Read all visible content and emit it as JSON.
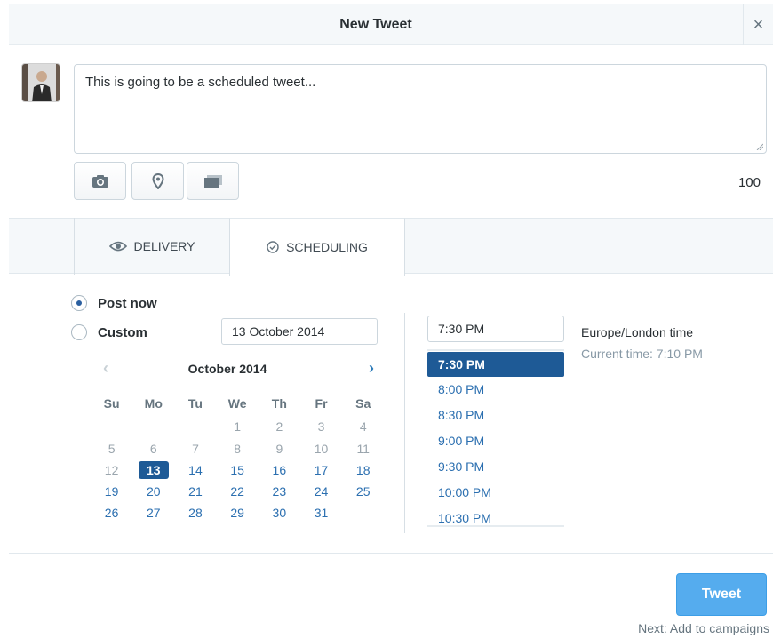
{
  "header": {
    "title": "New Tweet",
    "close_symbol": "×"
  },
  "composer": {
    "text": "This is going to be a scheduled tweet...",
    "char_count": "100",
    "media_buttons": [
      "camera-icon",
      "location-pin-icon",
      "cards-icon"
    ]
  },
  "tabs": [
    {
      "label": "DELIVERY",
      "icon": "eye-icon"
    },
    {
      "label": "SCHEDULING",
      "icon": "clock-check-icon"
    }
  ],
  "schedule": {
    "post_now_label": "Post now",
    "custom_label": "Custom",
    "selected_option": "Post now",
    "date_value": "13 October 2014",
    "calendar": {
      "title": "October 2014",
      "weekdays": [
        "Su",
        "Mo",
        "Tu",
        "We",
        "Th",
        "Fr",
        "Sa"
      ],
      "weeks": [
        [
          "",
          "",
          "",
          "1",
          "2",
          "3",
          "4"
        ],
        [
          "5",
          "6",
          "7",
          "8",
          "9",
          "10",
          "11"
        ],
        [
          "12",
          "13",
          "14",
          "15",
          "16",
          "17",
          "18"
        ],
        [
          "19",
          "20",
          "21",
          "22",
          "23",
          "24",
          "25"
        ],
        [
          "26",
          "27",
          "28",
          "29",
          "30",
          "31",
          ""
        ]
      ],
      "selected_day": "13"
    },
    "time_value": "7:30 PM",
    "time_options": [
      "7:30 PM",
      "8:00 PM",
      "8:30 PM",
      "9:00 PM",
      "9:30 PM",
      "10:00 PM",
      "10:30 PM"
    ],
    "selected_time": "7:30 PM",
    "timezone_label": "Europe/London time",
    "current_time": "Current time: 7:10 PM"
  },
  "footer": {
    "tweet_label": "Tweet",
    "next_label": "Next: Add to campaigns"
  },
  "colors": {
    "accent": "#55acee",
    "selected": "#1e5a96",
    "link": "#2b6fb0"
  }
}
